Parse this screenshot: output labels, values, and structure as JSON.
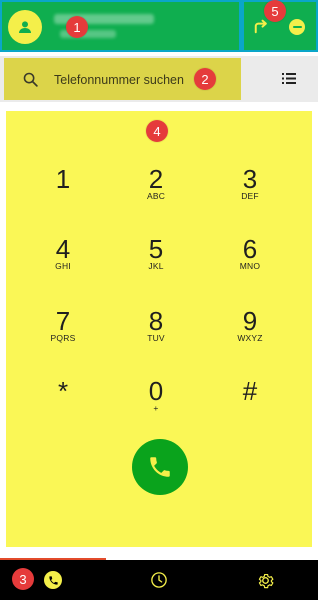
{
  "header": {
    "profile": {
      "avatar_icon": "person-icon"
    },
    "actions": {
      "call_forward_icon": "call-forward-icon",
      "dnd_icon": "do-not-disturb-icon"
    }
  },
  "search": {
    "placeholder": "Telefonnummer suchen",
    "search_icon": "search-icon",
    "list_icon": "list-icon"
  },
  "dialpad": {
    "keys": [
      {
        "digit": "1",
        "letters": ""
      },
      {
        "digit": "2",
        "letters": "ABC"
      },
      {
        "digit": "3",
        "letters": "DEF"
      },
      {
        "digit": "4",
        "letters": "GHI"
      },
      {
        "digit": "5",
        "letters": "JKL"
      },
      {
        "digit": "6",
        "letters": "MNO"
      },
      {
        "digit": "7",
        "letters": "PQRS"
      },
      {
        "digit": "8",
        "letters": "TUV"
      },
      {
        "digit": "9",
        "letters": "WXYZ"
      },
      {
        "digit": "*",
        "letters": ""
      },
      {
        "digit": "0",
        "letters": "+"
      },
      {
        "digit": "#",
        "letters": ""
      }
    ],
    "call_icon": "phone-icon"
  },
  "bottom_nav": {
    "items": [
      {
        "name": "dialer",
        "icon": "phone-icon",
        "active": true
      },
      {
        "name": "history",
        "icon": "clock-icon",
        "active": false
      },
      {
        "name": "settings",
        "icon": "gear-icon",
        "active": false
      }
    ]
  },
  "markers": [
    "1",
    "2",
    "3",
    "4",
    "5"
  ],
  "colors": {
    "header_border": "#0aa6c9",
    "header_green": "#0fae4f",
    "accent_yellow": "#f4ef4a",
    "search_box": "#dcd449",
    "dialpad_bg": "#faf756",
    "call_green": "#0aa31c",
    "marker_red": "#e53b3b",
    "nav_indicator": "#e24b2b"
  }
}
